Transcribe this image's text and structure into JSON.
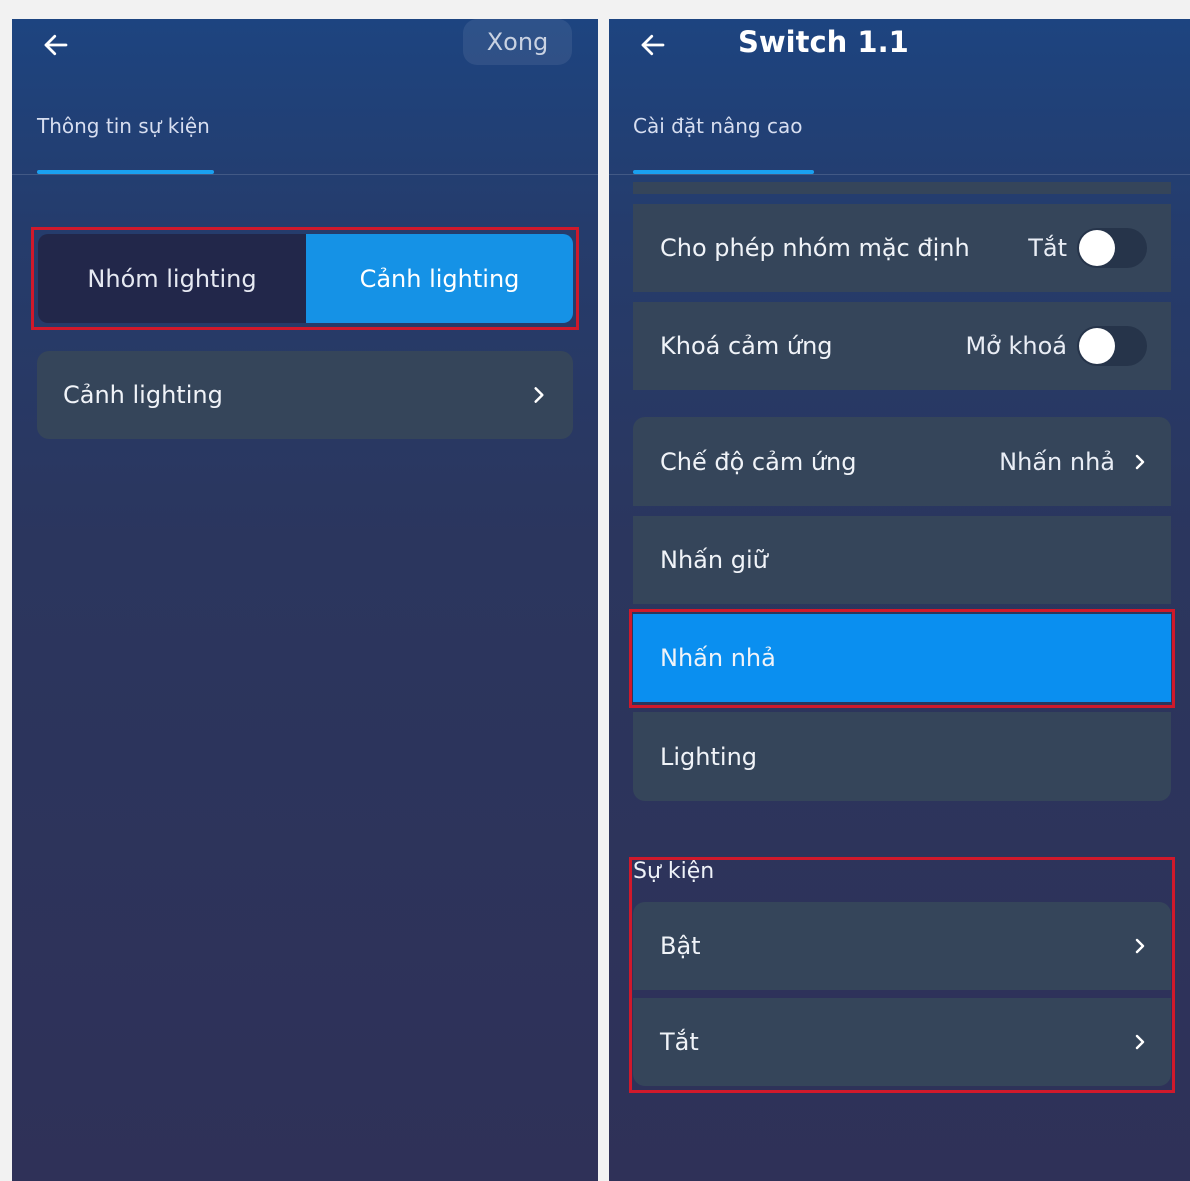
{
  "left": {
    "done_label": "Xong",
    "tab_label": "Thông tin sự kiện",
    "segment": {
      "options": [
        "Nhóm lighting",
        "Cảnh lighting"
      ],
      "selected": "Cảnh lighting"
    },
    "row_label": "Cảnh lighting"
  },
  "right": {
    "title": "Switch 1.1",
    "tab_label": "Cài đặt nâng cao",
    "default_group": {
      "label": "Cho phép nhóm mặc định",
      "value": "Tắt"
    },
    "touch_lock": {
      "label": "Khoá cảm ứng",
      "value": "Mở khoá"
    },
    "touch_mode": {
      "label": "Chế độ cảm ứng",
      "value": "Nhấn nhả",
      "options": [
        "Nhấn giữ",
        "Nhấn nhả",
        "Lighting"
      ],
      "selected": "Nhấn nhả"
    },
    "events": {
      "section_label": "Sự kiện",
      "items": [
        "Bật",
        "Tắt"
      ]
    }
  },
  "colors": {
    "accent": "#1592e6",
    "highlight_border": "#d0192b",
    "card": "#35455a"
  },
  "icons": {
    "back": "arrow-left-icon",
    "chevron": "chevron-right-icon"
  }
}
